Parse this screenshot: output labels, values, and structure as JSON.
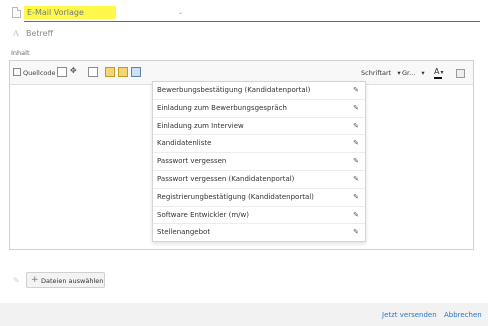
{
  "template": {
    "placeholder": "E-Mail Vorlage"
  },
  "subject": {
    "label": "Betreff"
  },
  "content": {
    "label": "Inhalt"
  },
  "toolbar": {
    "source_label": "Quellcode",
    "font_label": "Schriftart",
    "size_label": "Gr..."
  },
  "templates": [
    {
      "label": "Bewerbungsbestätigung (Kandidatenportal)"
    },
    {
      "label": "Einladung zum Bewerbungsgespräch"
    },
    {
      "label": "Einladung zum Interview"
    },
    {
      "label": "Kandidatenliste"
    },
    {
      "label": "Passwort vergessen"
    },
    {
      "label": "Passwort vergessen (Kandidatenportal)"
    },
    {
      "label": "Registrierungbestätigung (Kandidatenportal)"
    },
    {
      "label": "Software Entwickler (m/w)"
    },
    {
      "label": "Stellenangebot"
    }
  ],
  "attachments": {
    "button_label": "Dateien auswählen"
  },
  "footer": {
    "send_label": "Jetzt versenden",
    "cancel_label": "Abbrechen"
  },
  "colors": {
    "accent": "#2b78c2",
    "highlight": "#fff84a"
  }
}
